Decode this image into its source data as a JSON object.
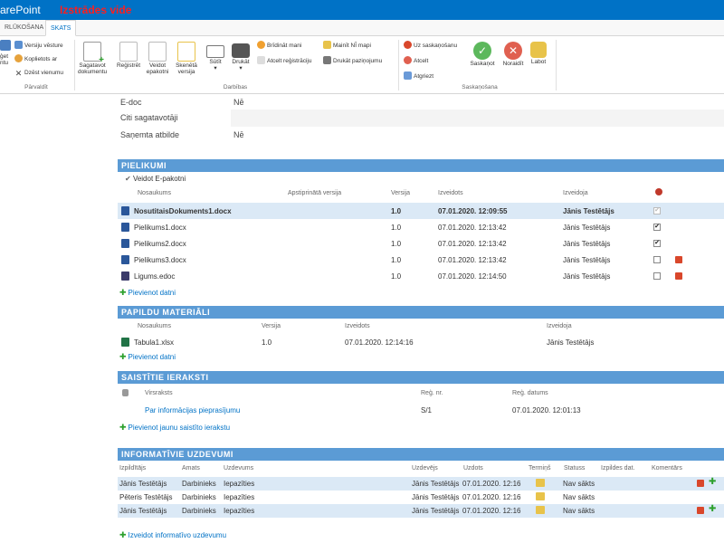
{
  "suitebar": {
    "app_title": "arePoint",
    "mode_label": "Izstrādes vide"
  },
  "ribbon_tabs": [
    "RLŪKOŠANA",
    "SKATS"
  ],
  "ribbon": {
    "manage": {
      "items": [
        "Versiju vēsture",
        "Koplietots ar",
        "Dzēst vienumu"
      ],
      "partial_button": [
        "ģet",
        "ntu"
      ],
      "group_label": "Pārvaldīt"
    },
    "actions": {
      "big_buttons": [
        {
          "label1": "Sagatavot",
          "label2": "dokumentu",
          "icon": "new-document-icon"
        },
        {
          "label1": "Reģistrēt",
          "label2": "",
          "icon": "register-icon"
        },
        {
          "label1": "Veidot",
          "label2": "epakotni",
          "icon": "epackage-icon"
        },
        {
          "label1": "Skenētā",
          "label2": "versija",
          "icon": "scan-icon"
        },
        {
          "label1": "Sūtīt",
          "label2": "▾",
          "icon": "send-icon"
        },
        {
          "label1": "Drukāt",
          "label2": "▾",
          "icon": "print-icon"
        }
      ],
      "small_buttons": [
        "Brīdināt mani",
        "Atcelt reģistrāciju",
        "Mainīt NĪ mapi",
        "Drukāt paziņojumu"
      ],
      "group_label": "Darbības"
    },
    "approval": {
      "small_buttons": [
        "Uz saskaņošanu",
        "Atcelt",
        "Atgriezt"
      ],
      "big_buttons": [
        "Saskaņot",
        "Noraidīt",
        "Labot"
      ],
      "group_label": "Saskaņošana"
    }
  },
  "fields": [
    {
      "label": "E-doc",
      "value": "Nē"
    },
    {
      "label": "Citi sagatavotāji",
      "value": ""
    },
    {
      "label": "Saņemta atbilde",
      "value": "Nē"
    }
  ],
  "attachments": {
    "title": "PIELIKUMI",
    "checkbox_label": "Veidot E-pakotni",
    "columns": [
      "Nosaukums",
      "Apstiprinātā versija",
      "Versija",
      "Izveidots",
      "Izveidoja"
    ],
    "rows": [
      {
        "name": "NosutitaisDokuments1.docx",
        "version": "1.0",
        "created": "07.01.2020. 12:09:55",
        "author": "Jānis Testētājs",
        "checked": "✔",
        "bold": true
      },
      {
        "name": "Pielikums1.docx",
        "version": "1.0",
        "created": "07.01.2020. 12:13:42",
        "author": "Jānis Testētājs",
        "checked": "✔"
      },
      {
        "name": "Pielikums2.docx",
        "version": "1.0",
        "created": "07.01.2020. 12:13:42",
        "author": "Jānis Testētājs",
        "checked": "✔"
      },
      {
        "name": "Pielikums3.docx",
        "version": "1.0",
        "created": "07.01.2020. 12:13:42",
        "author": "Jānis Testētājs",
        "checked": ""
      },
      {
        "name": "Ligums.edoc",
        "version": "1.0",
        "created": "07.01.2020. 12:14:50",
        "author": "Jānis Testētājs",
        "checked": ""
      }
    ],
    "add_label": "Pievienot datni"
  },
  "extra_materials": {
    "title": "PAPILDU MATERIĀLI",
    "columns": [
      "Nosaukums",
      "Versija",
      "Izveidots",
      "Izveidoja"
    ],
    "rows": [
      {
        "name": "Tabula1.xlsx",
        "version": "1.0",
        "created": "07.01.2020. 12:14:16",
        "author": "Jānis Testētājs"
      }
    ],
    "add_label": "Pievienot datni"
  },
  "related": {
    "title": "SAISTĪTIE IERAKSTI",
    "columns": [
      "Virsraksts",
      "Reģ. nr.",
      "Reģ. datums"
    ],
    "rows": [
      {
        "title": "Par informācijas pieprasījumu",
        "reg_nr": "S/1",
        "reg_date": "07.01.2020. 12:01:13"
      }
    ],
    "add_label": "Pievienot jaunu saistīto ierakstu"
  },
  "tasks": {
    "title": "INFORMATĪVIE UZDEVUMI",
    "columns": [
      "Izpildītājs",
      "Amats",
      "Uzdevums",
      "Uzdevējs",
      "Uzdots",
      "Termiņš",
      "Statuss",
      "Izpildes dat.",
      "Komentārs"
    ],
    "rows": [
      {
        "executor": "Jānis Testētājs",
        "position": "Darbinieks",
        "task": "Iepazīties",
        "assigner": "Jānis Testētājs",
        "assigned": "07.01.2020. 12:16",
        "status": "Nav sākts"
      },
      {
        "executor": "Pēteris Testētājs",
        "position": "Darbinieks",
        "task": "Iepazīties",
        "assigner": "Jānis Testētājs",
        "assigned": "07.01.2020. 12:16",
        "status": "Nav sākts"
      },
      {
        "executor": "Jānis Testētājs",
        "position": "Darbinieks",
        "task": "Iepazīties",
        "assigner": "Jānis Testētājs",
        "assigned": "07.01.2020. 12:16",
        "status": "Nav sākts"
      }
    ],
    "add_label": "Izveidot informatīvo uzdevumu"
  },
  "colors": {
    "accent": "#0072c6",
    "section_header": "#5b9bd5",
    "selected_row": "#dbe9f6"
  }
}
